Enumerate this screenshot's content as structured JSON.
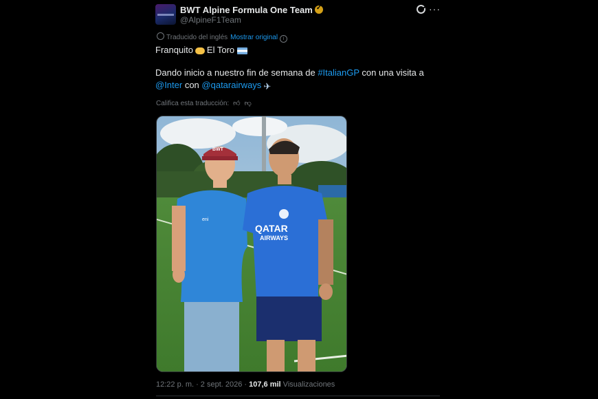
{
  "tweet": {
    "author_name": "BWT Alpine Formula One Team",
    "author_handle": "@AlpineF1Team",
    "translated_label": "Traducido del inglés",
    "show_original_label": "Mostrar original",
    "line1": {
      "a": "Franquito",
      "b": "El Toro"
    },
    "line2": {
      "pre": "Dando inicio a nuestro fin de semana de ",
      "hashtag": "#ItalianGP",
      "post": " con una visita a"
    },
    "line3": {
      "mention1": "@Inter",
      "mid": " con ",
      "mention2": "@qatarairways"
    },
    "rate_label": "Califica esta traducción:",
    "timestamp": "12:22 p. m. · 2 sept. 2026 · ",
    "views_count": "107,6 mil",
    "views_label": " Visualizaciones",
    "photo_text": {
      "shirt": "QATAR",
      "shirt2": "AIRWAYS",
      "alpine_sponsor": "eni",
      "cap": "BWT"
    }
  },
  "colors": {
    "background": "#000000",
    "text": "#e7e9ea",
    "muted": "#71767b",
    "link": "#1d9bf0",
    "verified": "#d4a017"
  },
  "icons": [
    "verified-badge-icon",
    "grok-icon",
    "more-icon",
    "translate-icon",
    "info-icon",
    "handshake-icon",
    "argentina-flag-icon",
    "airplane-icon",
    "thumbs-up-icon",
    "thumbs-down-icon"
  ]
}
